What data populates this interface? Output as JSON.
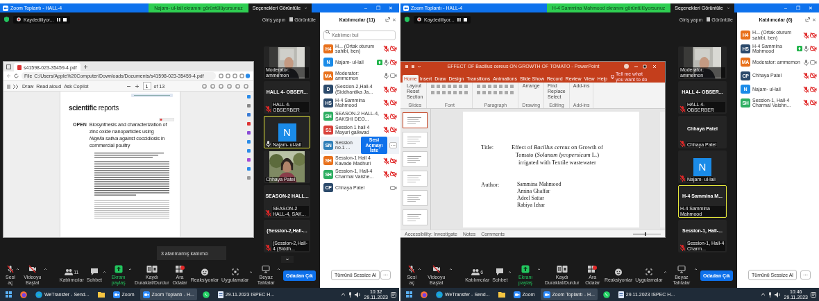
{
  "windows": [
    {
      "title": "Zoom Toplantı - HALL-4",
      "banner": "Najam- ul-lail ekranını görüntülüyorsunuz",
      "view_options": "Seçenekleri Görüntüle",
      "controls": [
        "–",
        "❐",
        "✕"
      ],
      "recording": "Kaydediliyor...",
      "sign_in": "Giriş yapın",
      "view": "Görüntüle",
      "shared": {
        "kind": "pdf",
        "tab": "s41598-023-35459-4.pdf",
        "file_label": "File",
        "address": "C:/Users/Apple%20Computer/Downloads/Documents/s41598-023-35459-4.pdf",
        "tools": [
          "Draw",
          "Read aloud",
          "Ask Copilot"
        ],
        "page": "1",
        "page_count": "of 13",
        "journal": "**scientific** reports",
        "open": "OPEN",
        "article_title": "Biosynthesis and characterization of zinc oxide nanoparticles using *Nigella sativa* against coccidiosis in commercial poultry"
      },
      "tiles": [
        {
          "kind": "video",
          "label": "Moderator: ammemon",
          "selected": false
        },
        {
          "kind": "name",
          "name": "HALL 4- OBSER...",
          "label": "HALL 4- OBSERBER",
          "muted": true,
          "selected": false
        },
        {
          "kind": "avatar",
          "initial": "N",
          "label": "Najam- ul-lail",
          "muted": false,
          "selected": true
        },
        {
          "kind": "video",
          "label": "Chhaya Patel",
          "selected": false
        },
        {
          "kind": "name",
          "name": "SEASON-2 HALL...",
          "label": "SEASON-2 HALL-4, SAK...",
          "muted": true,
          "selected": false
        },
        {
          "kind": "name",
          "name": "(Session-2,Hall-...",
          "label": "(Session-2,Hall-4 (Siddh...",
          "muted": true,
          "selected": false
        }
      ],
      "more_tiles": true,
      "toast": "3 atanmamış katılımcı",
      "panel": {
        "title": "Katılımcılar (11)",
        "close": "✕",
        "search_placeholder": "Katılımcı bul",
        "mute_all": "Tümünü Sessize Al",
        "more": "···",
        "participants": [
          {
            "initials": "H4",
            "color": "#e8711c",
            "name": "H... (Ortak oturum sahibi, ben)",
            "muted": true,
            "video_off": true
          },
          {
            "initials": "N",
            "color": "#1a8be8",
            "name": "Najam- ul-lail",
            "sharing": true,
            "muted": false,
            "video_off": true
          },
          {
            "initials": "MA",
            "color": "#e8711c",
            "name": "Moderator: ammemon",
            "muted": false,
            "video_off": false
          },
          {
            "initials": "D",
            "color": "#2c4a6b",
            "name": "(Session-2,Hall-4 (Siddhantika Ja...",
            "muted": true,
            "video_off": true
          },
          {
            "initials": "HS",
            "color": "#2c4a6b",
            "name": "H-4 Sammina Mahmood",
            "muted": true,
            "video_off": true
          },
          {
            "initials": "SH",
            "color": "#2eae62",
            "name": "SEASON-2 HALL-4, SAKSHI DEO...",
            "muted": true,
            "video_off": true
          },
          {
            "initials": "S1",
            "color": "#d9413a",
            "name": "Session 1 hall 4 Mayuri gaikwad",
            "muted": true,
            "video_off": true
          },
          {
            "initials": "SN",
            "color": "#2f7fb8",
            "name": "Session no.1 ...",
            "hover_button": "Sesi Açmayı İste",
            "more": "···"
          },
          {
            "initials": "SH",
            "color": "#e8711c",
            "name": "Session-1 Hall 4 Kavade Madhuri",
            "muted": true,
            "video_off": true
          },
          {
            "initials": "SH",
            "color": "#2eae62",
            "name": "Session-1, Hall-4 Charmal Vaishe...",
            "muted": true,
            "video_off": true
          },
          {
            "initials": "CP",
            "color": "#2c4a6b",
            "name": "Chhaya Patel",
            "video_off": false
          }
        ]
      },
      "toolbar": [
        {
          "kind": "mic",
          "label": "Sesi aç"
        },
        {
          "kind": "video",
          "label": "Videoyu Başlat"
        },
        {
          "kind": "participants",
          "label": "Katılımcılar",
          "count": "11"
        },
        {
          "kind": "chat",
          "label": "Sohbet"
        },
        {
          "kind": "share",
          "label": "Ekranı paylaş"
        },
        {
          "kind": "record",
          "label": "Kaydı Duraklat/Durdur"
        },
        {
          "kind": "rooms",
          "label": "Ara Odalar"
        },
        {
          "kind": "reactions",
          "label": "Reaksiyonlar"
        },
        {
          "kind": "apps",
          "label": "Uygulamalar"
        },
        {
          "kind": "whiteboard",
          "label": "Beyaz Tahtalar"
        }
      ],
      "leave": "Odadan Çık",
      "taskbar": {
        "apps": [
          {
            "kind": "start"
          },
          {
            "kind": "firefox"
          },
          {
            "kind": "edge",
            "label": "WeTransfer - Send..."
          },
          {
            "kind": "folder"
          },
          {
            "kind": "zoom",
            "label": "Zoom"
          },
          {
            "kind": "zoom",
            "label": "Zoom Toplantı - H...",
            "selected": true
          },
          {
            "kind": "whatsapp"
          },
          {
            "kind": "document",
            "label": "29.11.2023 ISPEC H..."
          }
        ],
        "time": "10:32",
        "date": "29.11.2023"
      }
    },
    {
      "title": "Zoom Toplantı - HALL-4",
      "banner": "H-4 Sammina Mahmood ekranını görüntülüyorsunuz",
      "view_options": "Seçenekleri Görüntüle",
      "controls": [
        "–",
        "❐",
        "✕"
      ],
      "recording": "Kaydediliyor...",
      "sign_in": "Giriş yapın",
      "view": "Görüntüle",
      "shared": {
        "kind": "powerpoint",
        "title": "EFFECT OF Bacillus cereus ON GROWTH OF TOMATO - PowerPoint",
        "tabs": [
          {
            "label": "Home",
            "selected": true
          },
          {
            "label": "Insert",
            "selected": false
          },
          {
            "label": "Draw",
            "selected": false
          },
          {
            "label": "Design",
            "selected": false
          },
          {
            "label": "Transitions",
            "selected": false
          },
          {
            "label": "Animations",
            "selected": false
          },
          {
            "label": "Slide Show",
            "selected": false
          },
          {
            "label": "Record",
            "selected": false
          },
          {
            "label": "Review",
            "selected": false
          },
          {
            "label": "View",
            "selected": false
          },
          {
            "label": "Help",
            "selected": false
          }
        ],
        "tell_me": "Tell me what you want to do",
        "ribbon": [
          {
            "label": "Slides",
            "commands": [
              "Layout",
              "Reset",
              "Section"
            ]
          },
          {
            "label": "Font"
          },
          {
            "label": "Paragraph"
          },
          {
            "label": "Drawing",
            "commands": [
              "Arrange"
            ]
          },
          {
            "label": "Editing",
            "commands": [
              "Find",
              "Replace",
              "Select"
            ]
          },
          {
            "label": "Add-ins",
            "commands": [
              "Add-ins"
            ]
          }
        ],
        "thumbnails": [
          {
            "selected": true
          },
          {
            "selected": false
          },
          {
            "selected": false
          },
          {
            "selected": false
          },
          {
            "selected": false
          },
          {
            "selected": false
          }
        ],
        "slide": {
          "title_label": "Title:",
          "title": "Effect of *Bacillus cereus* on Growth of\nTomato (*Solanum lycopersicum* L.)\nirrigated with Textile wastewater",
          "author_label": "Author:",
          "authors": [
            "Sammina Mahmood",
            "Amina Ghaffar",
            "Adeel Sattar",
            "Rabiya Izhar"
          ]
        },
        "status": [
          "Accessibility: Investigate",
          "Notes",
          "Comments"
        ],
        "zoom": {
          "level": 0.45
        }
      },
      "tiles": [
        {
          "kind": "video",
          "label": "Moderator: ammemon",
          "selected": false
        },
        {
          "kind": "name",
          "name": "HALL 4- OBSER...",
          "label": "HALL 4- OBSERBER",
          "muted": true,
          "selected": false
        },
        {
          "kind": "name",
          "name": "Chhaya Patel",
          "label": "Chhaya Patel",
          "muted": true,
          "selected": false
        },
        {
          "kind": "avatar",
          "initial": "N",
          "label": "Najam- ul-lail",
          "muted": true,
          "selected": false
        },
        {
          "kind": "name",
          "name": "H-4 Sammina M...",
          "label": "H-4 Sammina Mahmood",
          "selected": true
        },
        {
          "kind": "name",
          "name": "Session-1,  Hall-...",
          "label": "Session-1, Hall-4 Charm...",
          "muted": true,
          "selected": false
        }
      ],
      "more_tiles": false,
      "panel": {
        "title": "Katılımcılar (6)",
        "close": "✕",
        "mute_all": "Tümünü Sessize Al",
        "more": "···",
        "participants": [
          {
            "initials": "H4",
            "color": "#e8711c",
            "name": "H... (Ortak oturum sahibi, ben)",
            "muted": true,
            "video_off": true
          },
          {
            "initials": "HS",
            "color": "#2c4a6b",
            "name": "H-4 Sammina Mahmood",
            "sharing": true,
            "muted": false,
            "video_off": true
          },
          {
            "initials": "MA",
            "color": "#e8711c",
            "name": "Moderator: ammemon",
            "muted": false,
            "video_off": false
          },
          {
            "initials": "CP",
            "color": "#2c4a6b",
            "name": "Chhaya Patel",
            "muted": true,
            "video_off": true
          },
          {
            "initials": "N",
            "color": "#1a8be8",
            "name": "Najam- ul-lail",
            "muted": true,
            "video_off": true
          },
          {
            "initials": "SH",
            "color": "#2eae62",
            "name": "Session-1, Hall-4 Charmal Vaishn...",
            "muted": true,
            "video_off": true
          }
        ]
      },
      "toolbar": [
        {
          "kind": "mic",
          "label": "Sesi aç"
        },
        {
          "kind": "video",
          "label": "Videoyu Başlat"
        },
        {
          "kind": "participants",
          "label": "Katılımcılar",
          "count": "6"
        },
        {
          "kind": "chat",
          "label": "Sohbet"
        },
        {
          "kind": "share",
          "label": "Ekranı paylaş"
        },
        {
          "kind": "record",
          "label": "Kaydı Duraklat/Durdur"
        },
        {
          "kind": "rooms",
          "label": "Ara Odalar"
        },
        {
          "kind": "reactions",
          "label": "Reaksiyonlar"
        },
        {
          "kind": "apps",
          "label": "Uygulamalar"
        },
        {
          "kind": "whiteboard",
          "label": "Beyaz Tahtalar"
        }
      ],
      "leave": "Odadan Çık",
      "taskbar": {
        "apps": [
          {
            "kind": "start"
          },
          {
            "kind": "firefox"
          },
          {
            "kind": "edge",
            "label": "WeTransfer - Send..."
          },
          {
            "kind": "folder"
          },
          {
            "kind": "zoom",
            "label": "Zoom"
          },
          {
            "kind": "zoom",
            "label": "Zoom Toplantı - H...",
            "selected": true
          },
          {
            "kind": "whatsapp"
          },
          {
            "kind": "document",
            "label": "29.11.2023 ISPEC H..."
          }
        ],
        "time": "10:46",
        "date": "29.11.2023"
      }
    }
  ]
}
